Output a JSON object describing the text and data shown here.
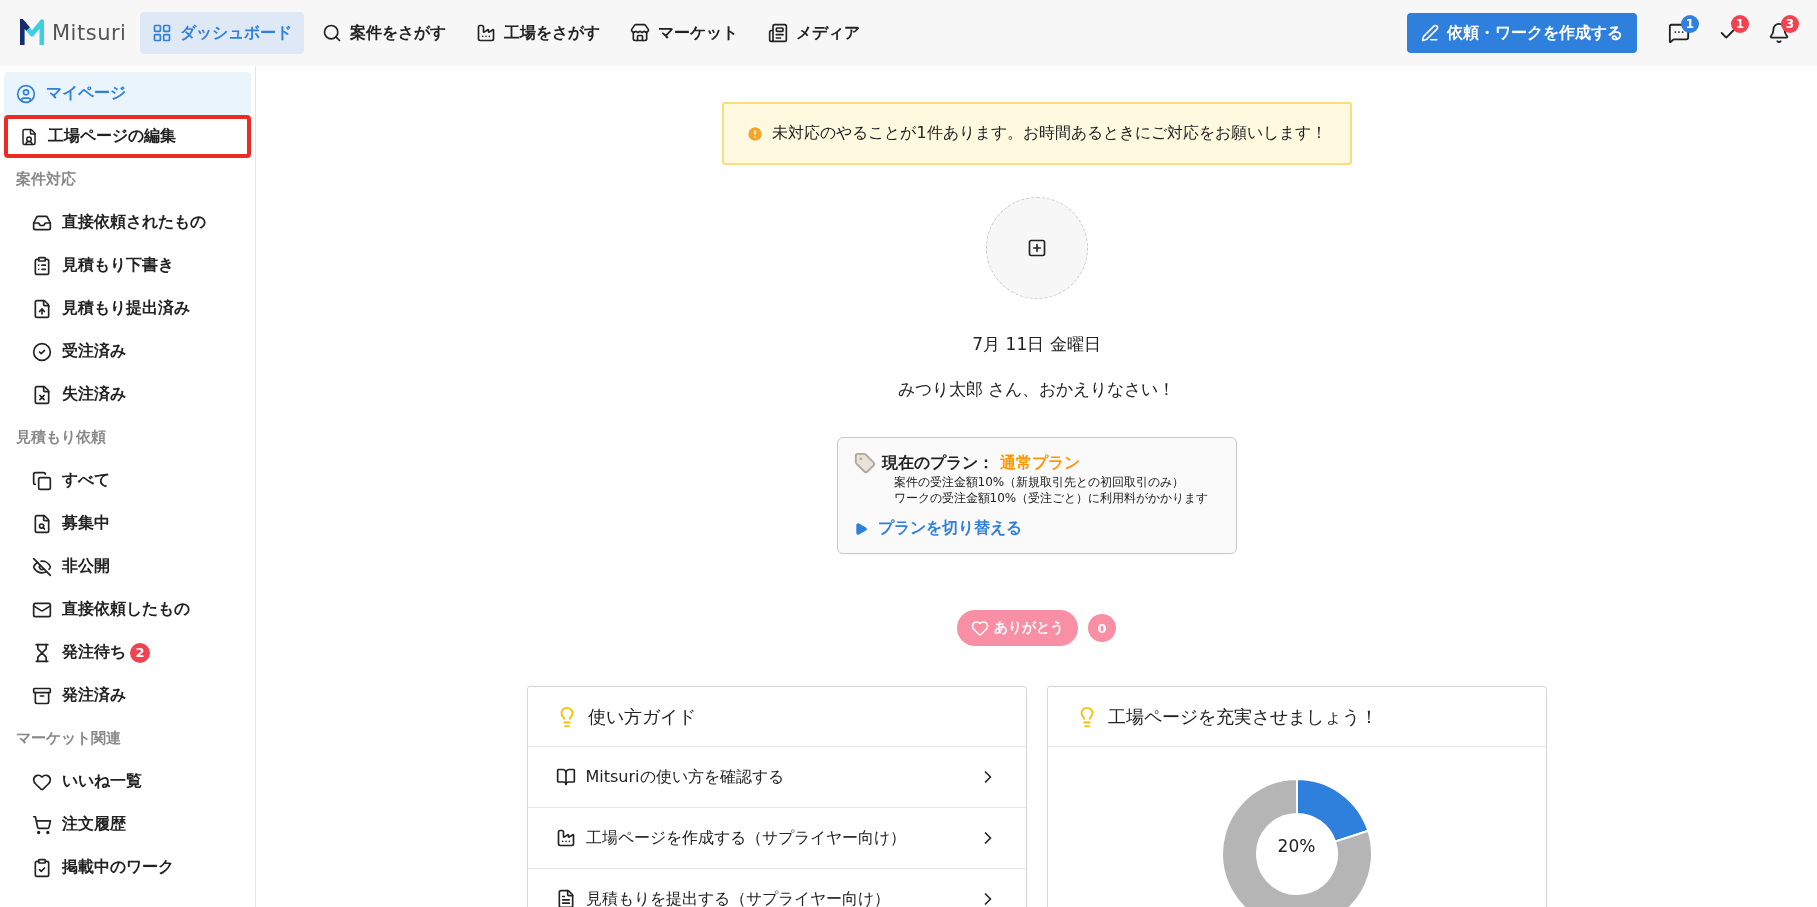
{
  "header": {
    "logo": "Mitsuri",
    "nav": [
      {
        "label": "ダッシュボード",
        "selected": true
      },
      {
        "label": "案件をさがす",
        "selected": false
      },
      {
        "label": "工場をさがす",
        "selected": false
      },
      {
        "label": "マーケット",
        "selected": false
      },
      {
        "label": "メディア",
        "selected": false
      }
    ],
    "create_button": "依頼・ワークを作成する",
    "icons": [
      {
        "badge": "1",
        "color": "#2f80dd"
      },
      {
        "badge": "1",
        "color": "#f0424f"
      },
      {
        "badge": "3",
        "color": "#f0424f"
      }
    ]
  },
  "sidebar": {
    "top": [
      {
        "label": "マイページ",
        "selected": true,
        "highlighted": false
      },
      {
        "label": "工場ページの編集",
        "selected": false,
        "highlighted": true
      }
    ],
    "sections": [
      {
        "heading": "案件対応",
        "items": [
          {
            "label": "直接依頼されたもの"
          },
          {
            "label": "見積もり下書き"
          },
          {
            "label": "見積もり提出済み"
          },
          {
            "label": "受注済み"
          },
          {
            "label": "失注済み"
          }
        ]
      },
      {
        "heading": "見積もり依頼",
        "items": [
          {
            "label": "すべて"
          },
          {
            "label": "募集中"
          },
          {
            "label": "非公開"
          },
          {
            "label": "直接依頼したもの"
          },
          {
            "label": "発注待ち",
            "badge": "2"
          },
          {
            "label": "発注済み"
          }
        ]
      },
      {
        "heading": "マーケット関連",
        "items": [
          {
            "label": "いいね一覧"
          },
          {
            "label": "注文履歴"
          },
          {
            "label": "掲載中のワーク"
          }
        ]
      }
    ]
  },
  "alert": "未対応のやることが1件あります。お時間あるときにご対応をお願いします！",
  "date": "7月 11日 金曜日",
  "greeting": "みつり太郎 さん、おかえりなさい！",
  "plan": {
    "label": "現在のプラン：",
    "name": "通常プラン",
    "lines": [
      "案件の受注金額10%（新規取引先との初回取引のみ）",
      "ワークの受注金額10%（受注ごと）に利用料がかかります"
    ],
    "link": "プランを切り替える"
  },
  "thanks": {
    "label": "ありがとう",
    "count": "0"
  },
  "guide": {
    "title": "使い方ガイド",
    "rows": [
      "Mitsuriの使い方を確認する",
      "工場ページを作成する（サプライヤー向け）",
      "見積もりを提出する（サプライヤー向け）"
    ]
  },
  "profile": {
    "title": "工場ページを充実させましょう！",
    "progress": {
      "label": "20%",
      "chart_data": {
        "type": "donut",
        "values": [
          20,
          80
        ]
      }
    }
  }
}
